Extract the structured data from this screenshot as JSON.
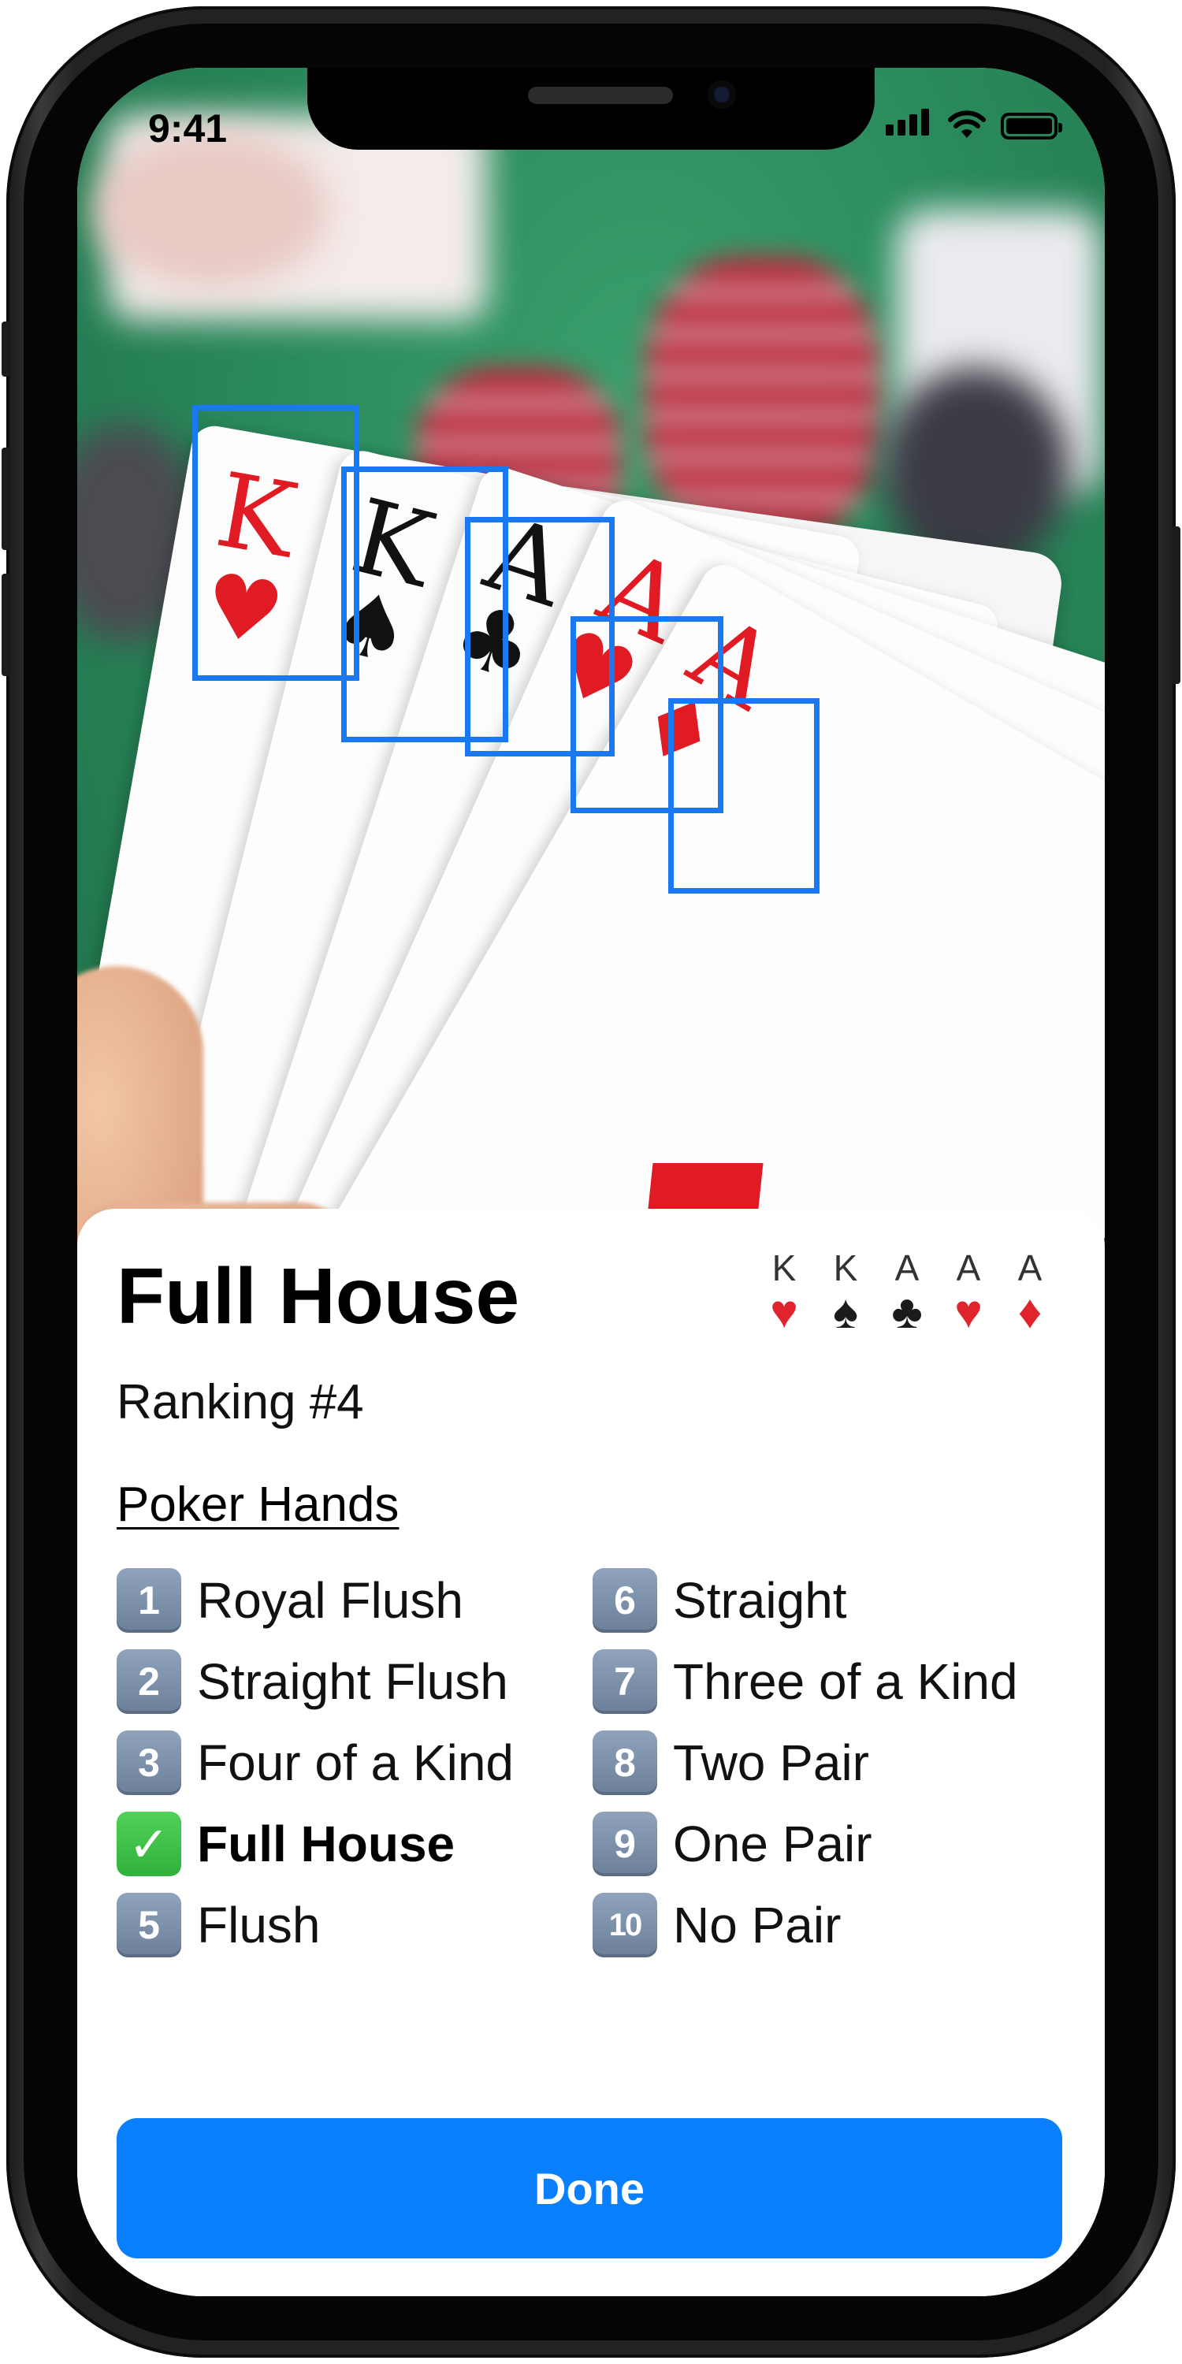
{
  "status_bar": {
    "time": "9:41"
  },
  "photo": {
    "cards": [
      {
        "rank": "K",
        "suit": "♥",
        "color": "red"
      },
      {
        "rank": "K",
        "suit": "♠",
        "color": "black"
      },
      {
        "rank": "A",
        "suit": "♣",
        "color": "black"
      },
      {
        "rank": "A",
        "suit": "♥",
        "color": "red"
      },
      {
        "rank": "A",
        "suit": "♦",
        "color": "red"
      }
    ]
  },
  "result": {
    "title": "Full House",
    "ranking": "Ranking #4",
    "mini_cards": [
      {
        "rank": "K",
        "suit": "♥",
        "color": "#e0242c"
      },
      {
        "rank": "K",
        "suit": "♠",
        "color": "#1b1b1b"
      },
      {
        "rank": "A",
        "suit": "♣",
        "color": "#1b1b1b"
      },
      {
        "rank": "A",
        "suit": "♥",
        "color": "#e0242c"
      },
      {
        "rank": "A",
        "suit": "♦",
        "color": "#e0242c"
      }
    ]
  },
  "poker_hands": {
    "heading": "Poker Hands",
    "items": [
      {
        "key": "1",
        "label": "Royal Flush"
      },
      {
        "key": "2",
        "label": "Straight Flush"
      },
      {
        "key": "3",
        "label": "Four of a Kind"
      },
      {
        "key": "✓",
        "label": "Full House"
      },
      {
        "key": "5",
        "label": "Flush"
      },
      {
        "key": "6",
        "label": "Straight"
      },
      {
        "key": "7",
        "label": "Three of a Kind"
      },
      {
        "key": "8",
        "label": "Two Pair"
      },
      {
        "key": "9",
        "label": "One Pair"
      },
      {
        "key": "10",
        "label": "No Pair"
      }
    ]
  },
  "actions": {
    "done_label": "Done"
  },
  "colors": {
    "accent": "#0a7ffe",
    "detection_box": "#1a78f0",
    "table_felt": "#2a8a5c"
  }
}
